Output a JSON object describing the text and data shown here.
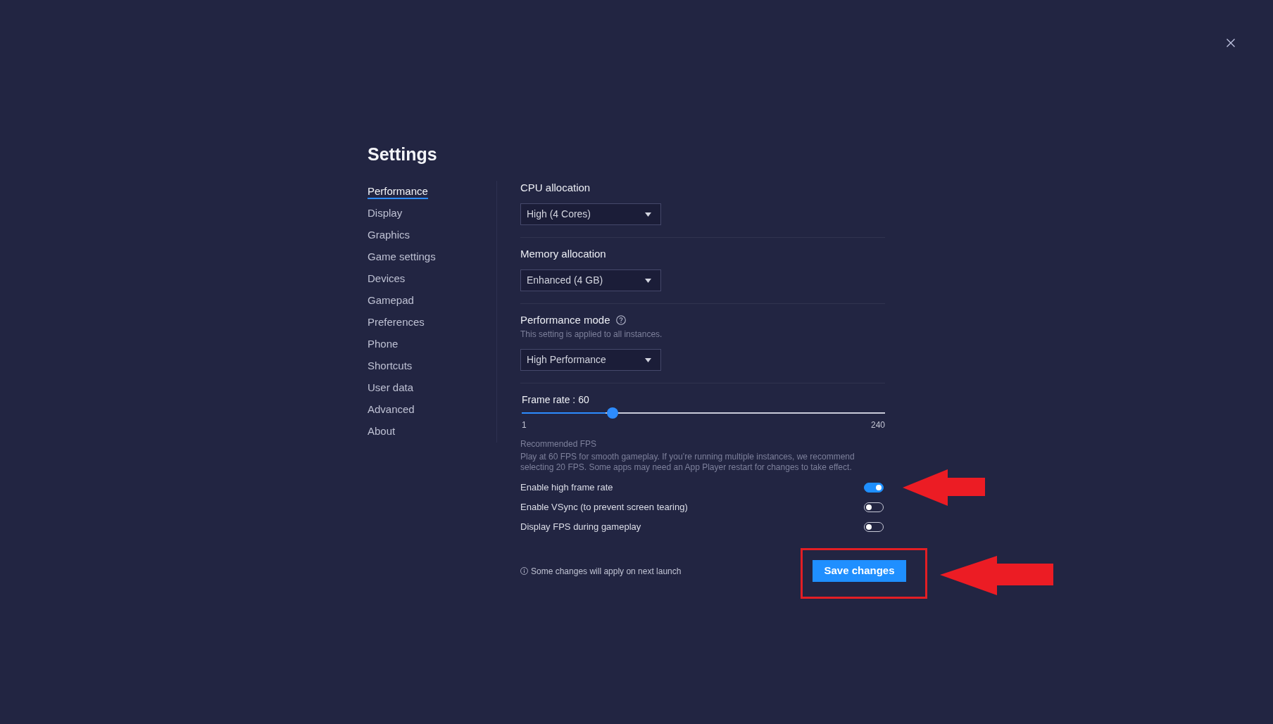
{
  "title": "Settings",
  "sidebar": {
    "items": [
      {
        "label": "Performance",
        "selected": true
      },
      {
        "label": "Display",
        "selected": false
      },
      {
        "label": "Graphics",
        "selected": false
      },
      {
        "label": "Game settings",
        "selected": false
      },
      {
        "label": "Devices",
        "selected": false
      },
      {
        "label": "Gamepad",
        "selected": false
      },
      {
        "label": "Preferences",
        "selected": false
      },
      {
        "label": "Phone",
        "selected": false
      },
      {
        "label": "Shortcuts",
        "selected": false
      },
      {
        "label": "User data",
        "selected": false
      },
      {
        "label": "Advanced",
        "selected": false
      },
      {
        "label": "About",
        "selected": false
      }
    ]
  },
  "sections": [
    {
      "label": "CPU allocation",
      "help": false,
      "value": "High (4 Cores)"
    },
    {
      "label": "Memory allocation",
      "help": false,
      "value": "Enhanced (4 GB)"
    },
    {
      "label": "Performance mode",
      "help": true,
      "description": "This setting is applied to all instances.",
      "value": "High Performance"
    }
  ],
  "frame_rate": {
    "label": "Frame rate : 60",
    "level": 0.25,
    "min_label": "1",
    "max_label": "240",
    "recommendation_title": "Recommended FPS",
    "recommendation_text": "Play at 60 FPS for smooth gameplay. If you’re running multiple instances, we recommend selecting 20 FPS. Some apps may need an App Player restart for changes to take effect."
  },
  "toggles": [
    {
      "label": "Enable high frame rate",
      "on": true,
      "arrow": true
    },
    {
      "label": "Enable VSync (to prevent screen tearing)",
      "on": false,
      "arrow": false
    },
    {
      "label": "Display FPS during gameplay",
      "on": false,
      "arrow": false
    }
  ],
  "footer": {
    "note": "Some changes will apply on next launch",
    "save": {
      "label": "Save changes",
      "highlighted": true,
      "arrow": true
    }
  }
}
